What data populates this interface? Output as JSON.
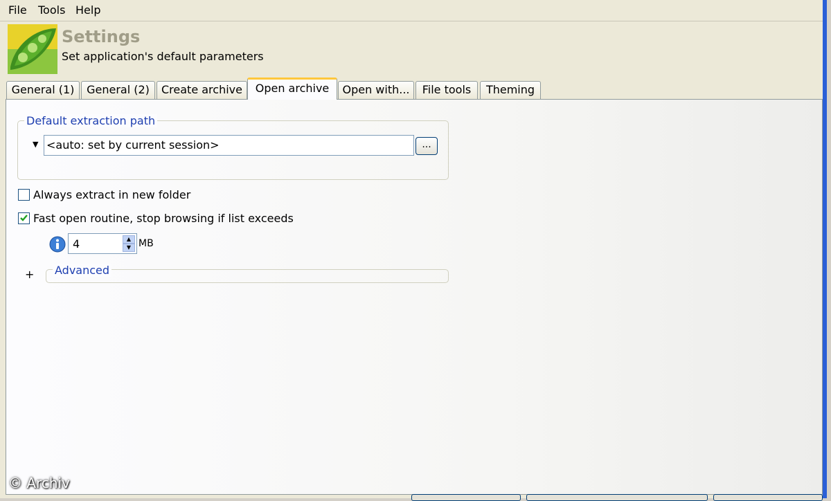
{
  "menu": {
    "file": "File",
    "tools": "Tools",
    "help": "Help"
  },
  "header": {
    "title": "Settings",
    "subtitle": "Set application's default parameters"
  },
  "tabs": [
    {
      "label": "General (1)"
    },
    {
      "label": "General (2)"
    },
    {
      "label": "Create archive"
    },
    {
      "label": "Open archive",
      "active": true
    },
    {
      "label": "Open with..."
    },
    {
      "label": "File tools"
    },
    {
      "label": "Theming"
    }
  ],
  "extraction": {
    "group_label": "Default extraction path",
    "path_value": "<auto: set by current session>",
    "browse_label": "..."
  },
  "options": {
    "always_extract_label": "Always extract in new folder",
    "always_extract_checked": false,
    "fast_open_label": "Fast open routine, stop browsing if list exceeds",
    "fast_open_checked": true,
    "size_value": "4",
    "size_unit": "MB"
  },
  "advanced": {
    "expander": "+",
    "label": "Advanced"
  },
  "watermark": "© Archiv",
  "colors": {
    "accent_blue": "#1e3fb0",
    "active_tab_highlight": "#ffc73c",
    "window_border": "#2a5fd7"
  }
}
